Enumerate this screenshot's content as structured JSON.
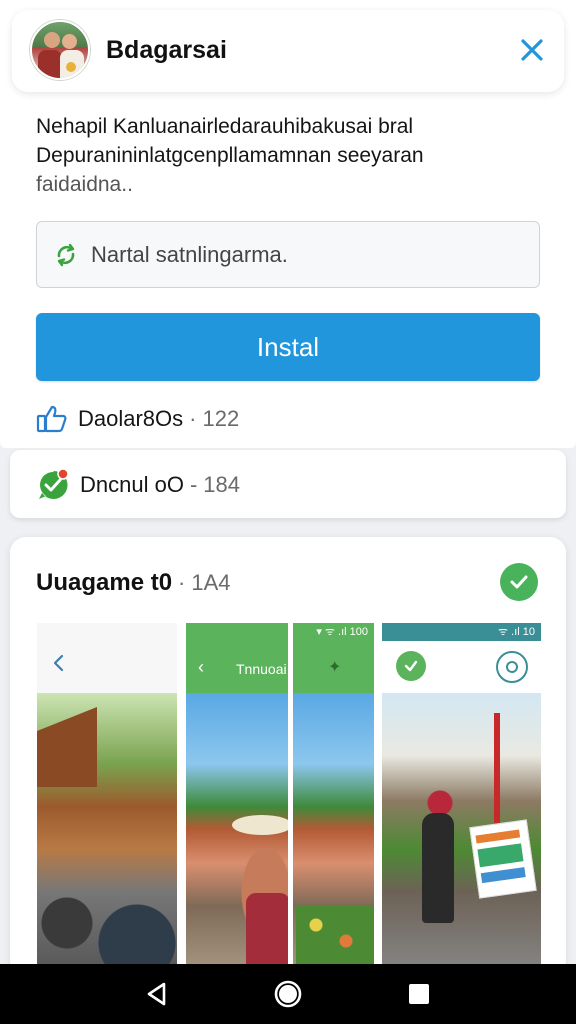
{
  "header": {
    "title": "Bdagarsai",
    "avatar_icon": "profile-photo",
    "close_icon": "close-icon"
  },
  "description": {
    "line1": "Nehapil Kanluanairledarauhibakusai bral",
    "line2": "Depuranininlatgcenpllamamnan seeyaran",
    "line3": "faidaidna.."
  },
  "search": {
    "text": "Nartal satnlingarma.",
    "icon": "refresh-icon"
  },
  "install_button": {
    "label": "Instal",
    "color": "#2196dc"
  },
  "stats": {
    "likes": {
      "label": "Daolar8Os",
      "separator": "·",
      "count": "122",
      "icon": "thumbs-up-icon"
    },
    "comments": {
      "label": "Dncnul oO",
      "separator": "-",
      "count": "184",
      "icon": "chat-check-icon"
    }
  },
  "gallery": {
    "title": "Uuagame t0",
    "separator": "·",
    "count": "1A4",
    "badge_icon": "check-icon",
    "screens": [
      {
        "name": "street-photo",
        "header_icon": "back-icon"
      },
      {
        "name": "green-header-photo",
        "header_title": "Tnnuoai",
        "header_icon": "back-icon",
        "status": "▾ ᯤ .ıl 100"
      },
      {
        "name": "card-photo",
        "status": "ᯤ .ıl 10"
      }
    ]
  },
  "nav": {
    "back_icon": "back-triangle-icon",
    "home_icon": "home-circle-icon",
    "recent_icon": "recent-square-icon"
  },
  "colors": {
    "accent": "#2196dc",
    "success": "#48b35a",
    "background": "#eef0f4"
  }
}
